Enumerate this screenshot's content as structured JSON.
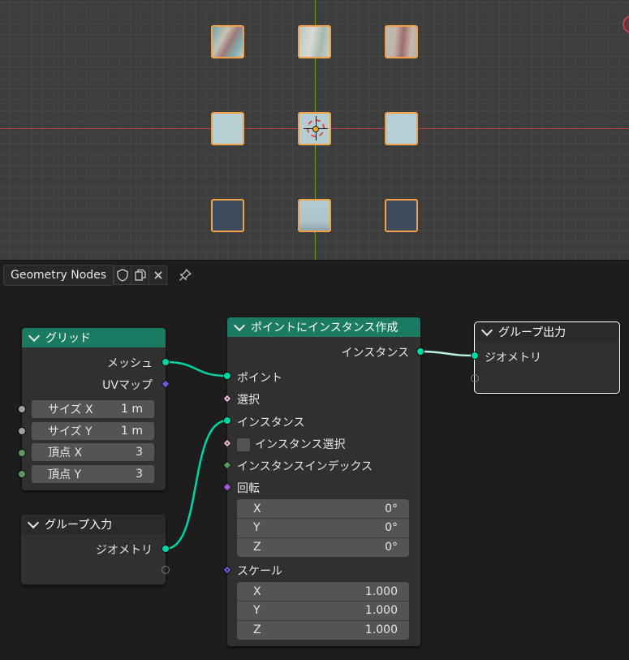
{
  "editor": {
    "tab_label": "Geometry Nodes",
    "shield_icon": "shield-icon",
    "copy_icon": "copy-icon",
    "close_icon": "close-icon",
    "pin_icon": "pin-icon"
  },
  "colors": {
    "geometry_node_header": "#1a7a62",
    "geometry_socket": "#00d6a3",
    "selection_outline": "#f0a24a"
  },
  "nodes": {
    "grid": {
      "title": "グリッド",
      "outputs": [
        "メッシュ",
        "UVマップ"
      ],
      "fields": [
        {
          "label": "サイズ X",
          "value": "1 m"
        },
        {
          "label": "サイズ Y",
          "value": "1 m"
        },
        {
          "label": "頂点 X",
          "value": "3"
        },
        {
          "label": "頂点 Y",
          "value": "3"
        }
      ]
    },
    "group_input": {
      "title": "グループ入力",
      "outputs": [
        "ジオメトリ"
      ]
    },
    "instance_on_points": {
      "title": "ポイントにインスタンス作成",
      "output": "インスタンス",
      "inputs": {
        "points": "ポイント",
        "selection": "選択",
        "instance": "インスタンス",
        "pick_instance": "インスタンス選択",
        "instance_index": "インスタンスインデックス",
        "rotation": "回転",
        "scale": "スケール"
      },
      "rotation": [
        {
          "axis": "X",
          "value": "0°"
        },
        {
          "axis": "Y",
          "value": "0°"
        },
        {
          "axis": "Z",
          "value": "0°"
        }
      ],
      "scale": [
        {
          "axis": "X",
          "value": "1.000"
        },
        {
          "axis": "Y",
          "value": "1.000"
        },
        {
          "axis": "Z",
          "value": "1.000"
        }
      ]
    },
    "group_output": {
      "title": "グループ出力",
      "inputs": [
        "ジオメトリ"
      ]
    }
  }
}
